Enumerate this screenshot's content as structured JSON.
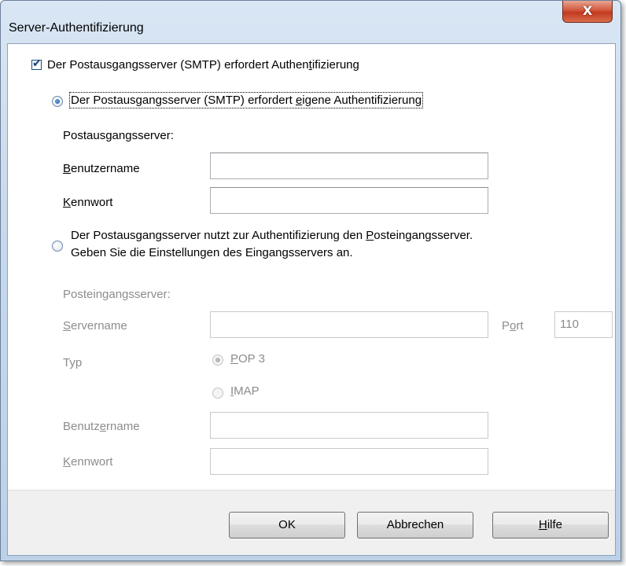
{
  "window": {
    "title": "Server-Authentifizierung",
    "close_glyph": "X"
  },
  "smtp_auth_checkbox": {
    "label_pre": "Der Postausgangsserver (SMTP) erfordert Authen",
    "label_key": "t",
    "label_post": "ifizierung",
    "checked": true
  },
  "option_own_auth": {
    "label_pre": "Der Postausgangsserver (SMTP) erfordert ",
    "label_key": "e",
    "label_post": "igene Authentifizierung",
    "selected": true
  },
  "outgoing_section": {
    "heading": "Postausgangsserver:",
    "username_label_key": "B",
    "username_label_rest": "enutzername",
    "username_value": "",
    "password_label_key": "K",
    "password_label_rest": "ennwort",
    "password_value": ""
  },
  "option_incoming_auth": {
    "line1_pre": "Der Postausgangsserver nutzt zur Authentifizierung den ",
    "line1_key": "P",
    "line1_post": "osteingangsserver.",
    "line2": "Geben Sie die Einstellungen des Eingangsservers an.",
    "selected": false
  },
  "incoming_section": {
    "heading": "Posteingangsserver:",
    "servername_label_key": "S",
    "servername_label_rest": "ervername",
    "servername_value": "",
    "port_label_pre": "P",
    "port_label_key": "o",
    "port_label_post": "rt",
    "port_value": "110",
    "type_label": "Typ",
    "type_options": {
      "pop3_key": "P",
      "pop3_rest": "OP 3",
      "imap_key": "I",
      "imap_rest": "MAP"
    },
    "selected_type": "POP 3",
    "username_label_pre": "Benutz",
    "username_label_key": "e",
    "username_label_post": "rname",
    "username_value": "",
    "password_label_key": "K",
    "password_label_rest": "ennwort",
    "password_value": ""
  },
  "buttons": {
    "ok": "OK",
    "cancel": "Abbrechen",
    "help_key": "H",
    "help_rest": "ilfe"
  },
  "colors": {
    "disabled_text": "#8c8c8c",
    "close_button": "#c23a1f",
    "title_bar": "#c8d9ec"
  }
}
